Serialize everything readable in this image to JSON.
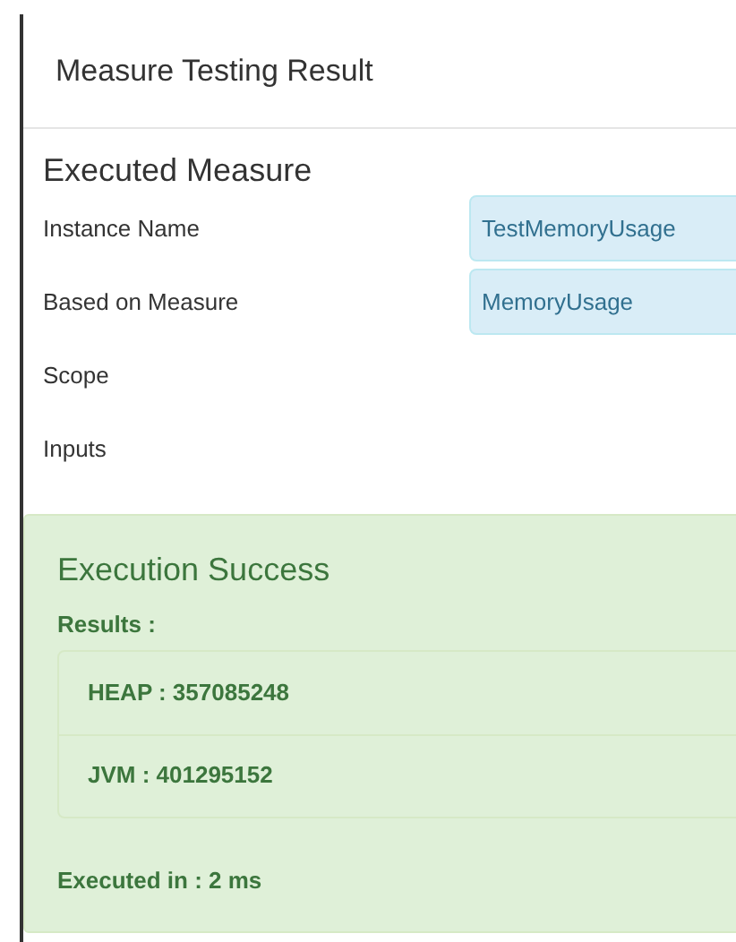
{
  "dialog": {
    "title": "Measure Testing Result"
  },
  "section_title": "Executed Measure",
  "fields": [
    {
      "label": "Instance Name",
      "value": "TestMemoryUsage"
    },
    {
      "label": "Based on Measure",
      "value": "MemoryUsage"
    },
    {
      "label": "Scope"
    },
    {
      "label": "Inputs"
    }
  ],
  "result": {
    "title": "Execution Success",
    "results_label": "Results :",
    "items": [
      "HEAP : 357085248",
      "JVM : 401295152"
    ],
    "executed_in": "Executed in : 2 ms"
  }
}
